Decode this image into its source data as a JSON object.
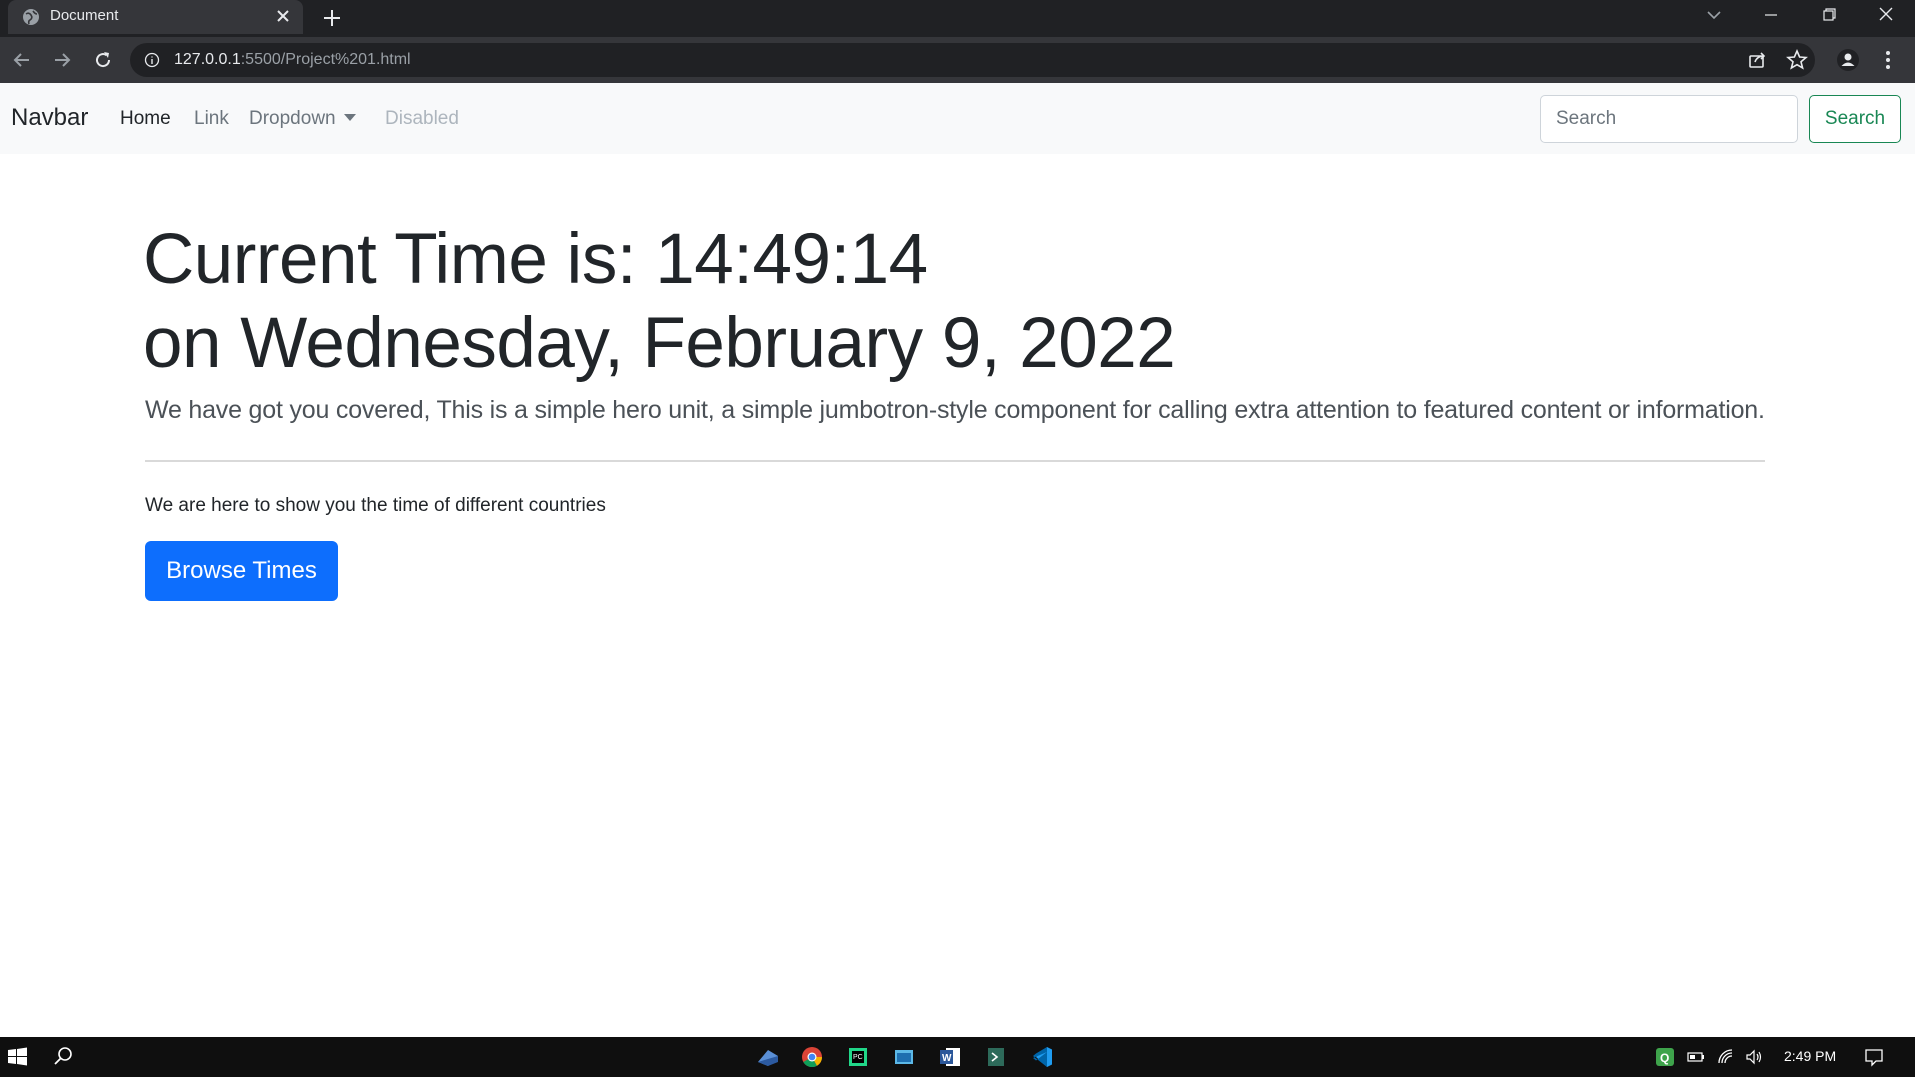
{
  "browser": {
    "tab_title": "Document",
    "url_host": "127.0.0.1",
    "url_rest": ":5500/Project%201.html",
    "icons": [
      "globe-favicon-icon",
      "close-tab-icon",
      "new-tab-icon",
      "tab-search-icon",
      "minimize-icon",
      "restore-icon",
      "close-window-icon",
      "back-icon",
      "forward-icon",
      "reload-icon",
      "site-info-icon",
      "share-icon",
      "bookmark-star-icon",
      "profile-icon",
      "menu-kebab-icon"
    ]
  },
  "navbar": {
    "brand": "Navbar",
    "links": [
      "Home",
      "Link",
      "Dropdown",
      "Disabled"
    ],
    "search_placeholder": "Search",
    "search_button": "Search"
  },
  "hero": {
    "title_line1": "Current Time is: 14:49:14",
    "title_line2": "on Wednesday, February 9, 2022",
    "lead": "We have got you covered, This is a simple hero unit, a simple jumbotron-style component for calling extra attention to featured content or information.",
    "text": "We are here to show you the time of different countries",
    "button": "Browse Times"
  },
  "colors": {
    "primary": "#0d6efd",
    "success": "#198754",
    "navbar_bg": "#f8f9fa",
    "chrome_dark": "#202124"
  },
  "taskbar": {
    "clock": "2:49 PM",
    "apps": [
      "start-icon",
      "search-icon",
      "app-icon",
      "chrome-icon",
      "pycharm-icon",
      "explorer-icon",
      "word-icon",
      "terminal-icon",
      "vscode-icon"
    ],
    "tray": [
      "qbittorrent-icon",
      "battery-icon",
      "wifi-icon",
      "volume-icon",
      "notification-icon"
    ]
  }
}
